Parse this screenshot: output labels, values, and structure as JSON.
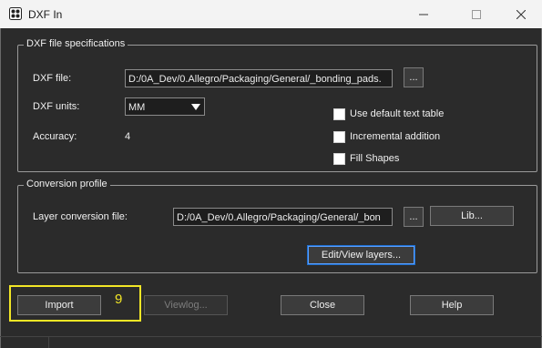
{
  "window": {
    "title": "DXF In"
  },
  "spec_group": {
    "title": "DXF file specifications",
    "dxf_file_label": "DXF file:",
    "dxf_file_value": "D:/0A_Dev/0.Allegro/Packaging/General/_bonding_pads.",
    "browse_label": "...",
    "units_label": "DXF units:",
    "units_value": "MM",
    "accuracy_label": "Accuracy:",
    "accuracy_value": "4",
    "options": [
      {
        "label": "Use default text table",
        "checked": false
      },
      {
        "label": "Incremental addition",
        "checked": false
      },
      {
        "label": "Fill Shapes",
        "checked": false
      }
    ]
  },
  "conversion_group": {
    "title": "Conversion profile",
    "layer_file_label": "Layer conversion file:",
    "layer_file_value": "D:/0A_Dev/0.Allegro/Packaging/General/_bon",
    "browse_label": "...",
    "lib_label": "Lib...",
    "edit_layers_label": "Edit/View layers..."
  },
  "actions": {
    "import_label": "Import",
    "viewlog_label": "Viewlog...",
    "close_label": "Close",
    "help_label": "Help"
  },
  "annotation": {
    "number": "9",
    "color": "#f2e626"
  },
  "colors": {
    "accent": "#1e6fd0",
    "background": "#2b2b2b"
  }
}
